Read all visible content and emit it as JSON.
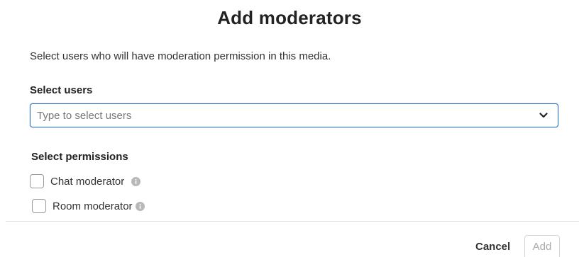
{
  "dialog": {
    "title": "Add moderators",
    "description": "Select users who will have moderation permission in this media.",
    "users": {
      "label": "Select users",
      "placeholder": "Type to select users",
      "value": "",
      "icon": "chevron-down-icon"
    },
    "permissions": {
      "label": "Select permissions",
      "items": [
        {
          "label": "Chat moderator",
          "checked": false,
          "icon": "info-icon"
        },
        {
          "label": "Room moderator",
          "checked": false,
          "icon": "info-icon"
        }
      ]
    },
    "footer": {
      "cancel_label": "Cancel",
      "add_label": "Add",
      "add_disabled": true
    }
  },
  "colors": {
    "focus_border": "#2f73b8",
    "info_icon": "#b8b8b8",
    "divider": "#dddddd",
    "disabled_text": "#aaaaaa"
  }
}
